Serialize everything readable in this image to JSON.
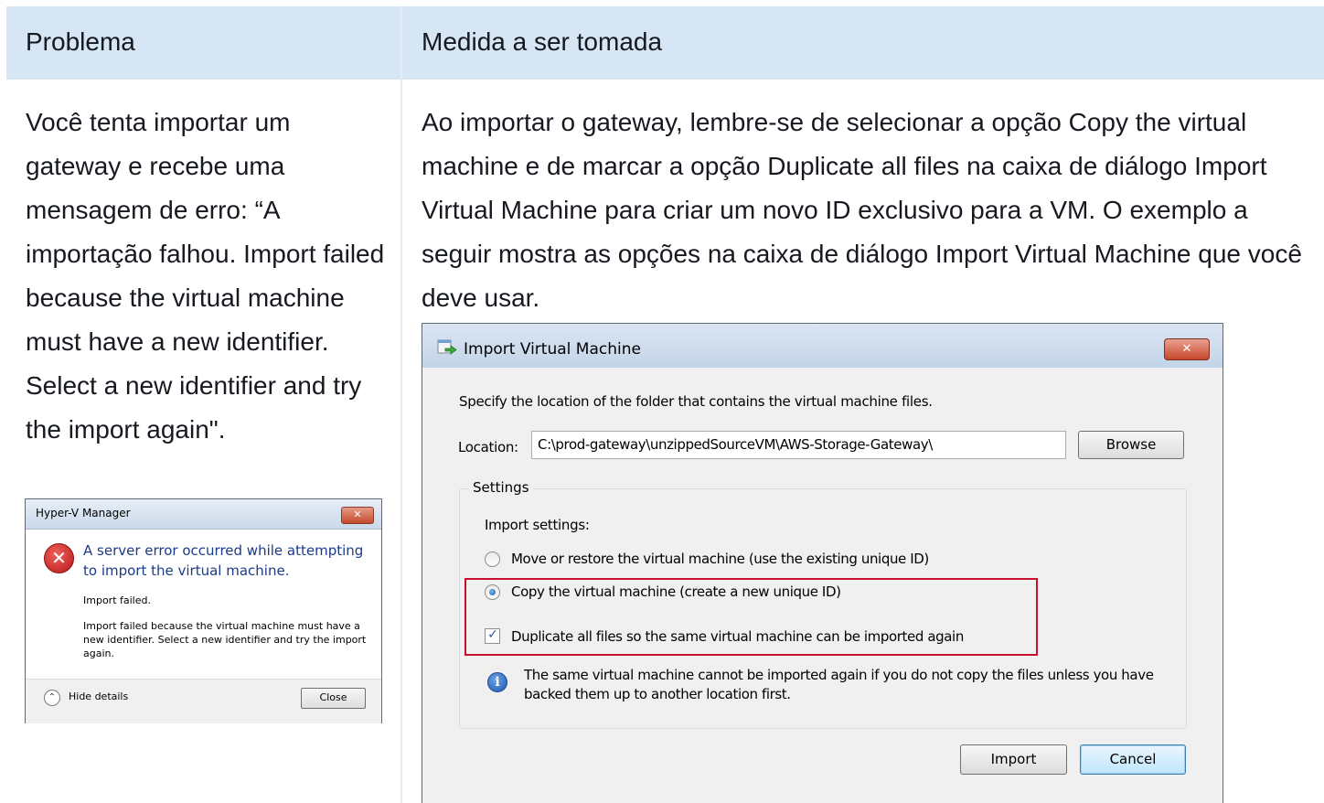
{
  "table": {
    "headers": [
      "Problema",
      "Medida a ser tomada"
    ],
    "problem_text": "Você tenta importar um gateway e recebe uma mensagem de erro: “A importação falhou. Import failed because the virtual machine must have a new identifier. Select a new identifier and try the import again\".",
    "action_text": "Ao importar o gateway, lembre-se de selecionar a opção Copy the virtual machine e de marcar a opção Duplicate all files na caixa de diálogo Import Virtual Machine para criar um novo ID exclusivo para a VM. O exemplo a seguir mostra as opções na caixa de diálogo Import Virtual Machine que você deve usar."
  },
  "hyperv_dialog": {
    "title": "Hyper-V Manager",
    "close_glyph": "✕",
    "error_icon": "error-icon",
    "main_message": "A server error occurred while attempting to import the virtual machine.",
    "detail_1": "Import failed.",
    "detail_2": "Import failed because the virtual machine must have a new identifier. Select a new identifier and try the import again.",
    "hide_details_label": "Hide details",
    "close_button_label": "Close"
  },
  "import_dialog": {
    "title": "Import Virtual Machine",
    "close_glyph": "✕",
    "instruction": "Specify the location of the folder that contains the virtual machine files.",
    "location_label": "Location:",
    "location_value": "C:\\prod-gateway\\unzippedSourceVM\\AWS-Storage-Gateway\\",
    "browse_label": "Browse",
    "settings_group_label": "Settings",
    "import_settings_label": "Import settings:",
    "option_move": "Move or restore the virtual machine (use the existing unique ID)",
    "option_copy": "Copy the virtual machine (create a new unique ID)",
    "option_duplicate": "Duplicate all files so the same virtual machine can be imported again",
    "selected_option": "copy",
    "duplicate_checked": true,
    "info_text": "The same virtual machine cannot be imported again if you do not copy the files unless you have backed them up to another location first.",
    "import_button_label": "Import",
    "cancel_button_label": "Cancel"
  },
  "colors": {
    "header_bg": "#d6e6f5",
    "highlight_red": "#c8102e"
  }
}
